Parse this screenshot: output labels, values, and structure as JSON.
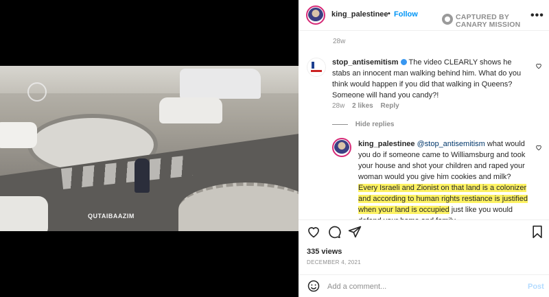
{
  "post": {
    "username": "king_palestinee",
    "dot": "•",
    "follow_label": "Follow",
    "captured_line1": "CAPTURED BY",
    "captured_line2": "CANARY MISSION",
    "more": "•••",
    "age": "28w",
    "video_watermark": "QUTAIBAAZIM"
  },
  "comments": [
    {
      "username": "stop_antisemitism",
      "text": "The video CLEARLY shows he stabs an innocent man walking behind him. What do you think would happen if you did that walking in Queens? Someone will hand you candy?!",
      "age": "28w",
      "likes": "2 likes",
      "reply": "Reply"
    }
  ],
  "replies": {
    "toggle_label": "Hide replies",
    "items": [
      {
        "username": "king_palestinee",
        "mention": "@stop_antisemitism",
        "text_before": " what would you do if someone came to Williamsburg and took your house and shot your children and raped your woman would you give him cookies and milk? ",
        "text_highlighted": "Every Israeli and Zionist on that land is a colonizer and according to human rights restiance is justified when your land is occupied",
        "text_after": " just like you would defend your home and family."
      }
    ]
  },
  "stats": {
    "views": "335 views",
    "date": "DECEMBER 4, 2021"
  },
  "add_comment": {
    "placeholder": "Add a comment...",
    "post_label": "Post"
  },
  "icons": {
    "like": "heart-icon",
    "comment": "comment-icon",
    "share": "paper-plane-icon",
    "save": "bookmark-icon",
    "emoji": "smiley-icon",
    "mute": "muted-speaker-icon",
    "captured": "canary-mission-icon"
  },
  "colors": {
    "link_blue": "#0095f6",
    "highlight": "#fdf263",
    "mention": "#00376b",
    "muted_text": "#8e8e8e"
  }
}
